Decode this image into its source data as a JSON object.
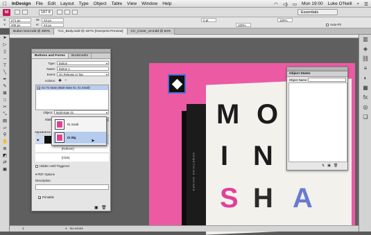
{
  "menubar": {
    "app_name": "InDesign",
    "items": [
      "File",
      "Edit",
      "Layout",
      "Type",
      "Object",
      "Table",
      "View",
      "Window",
      "Help"
    ],
    "clock": "Mon 19:00",
    "user": "Luke O'Neill"
  },
  "appbar": {
    "logo": "Id",
    "zoom": "187.8",
    "workspace": "Essentials"
  },
  "control": {
    "x": "271 px",
    "y": "208 px",
    "w": "43 px",
    "h": "43 px",
    "stroke": "0 pt",
    "opacity": "100%",
    "autofit": "Auto-Fit",
    "zoom2": "100%"
  },
  "doc_tabs": [
    "Button test.indd @ 280%",
    "*CC_Body.indd @ 187% [Overprint Preview]",
    "CC_Cover_v2.indd @ 54%"
  ],
  "buttons_panel": {
    "tabs": [
      "Buttons and Forms",
      "Bookmarks"
    ],
    "type_label": "Type:",
    "type_value": "Button",
    "name_label": "Name:",
    "name_value": "Button 1",
    "event_label": "Event:",
    "event_value": "On Release or Tap",
    "actions_label": "Actions:",
    "action_item": "Go To State (Multi-state 01: 01 Small)",
    "object_label": "Object:",
    "object_value": "Multi-state 01",
    "state_label": "State:",
    "state_value": "01 Small",
    "appearance_label": "Appearance",
    "appearance_rows": [
      "[Normal]",
      "[Rollover]",
      "[Click]"
    ],
    "hidden_label": "Hidden Until Triggered",
    "pdf_options": "PDF Options",
    "description_label": "Description:",
    "printable_label": "Printable"
  },
  "state_dropdown": {
    "options": [
      "01 Small",
      "01 Big"
    ],
    "selected": "01 Big"
  },
  "object_states_panel": {
    "title": "Object States",
    "name_label": "Object Name:"
  },
  "page": {
    "letters": [
      "M",
      "O",
      "I",
      "N",
      "S",
      "H",
      "A"
    ],
    "vertical_text": "SOMETHING SHINES",
    "pink": "#ec5aa4"
  },
  "status": {
    "page": "1",
    "errors": "No errors"
  }
}
